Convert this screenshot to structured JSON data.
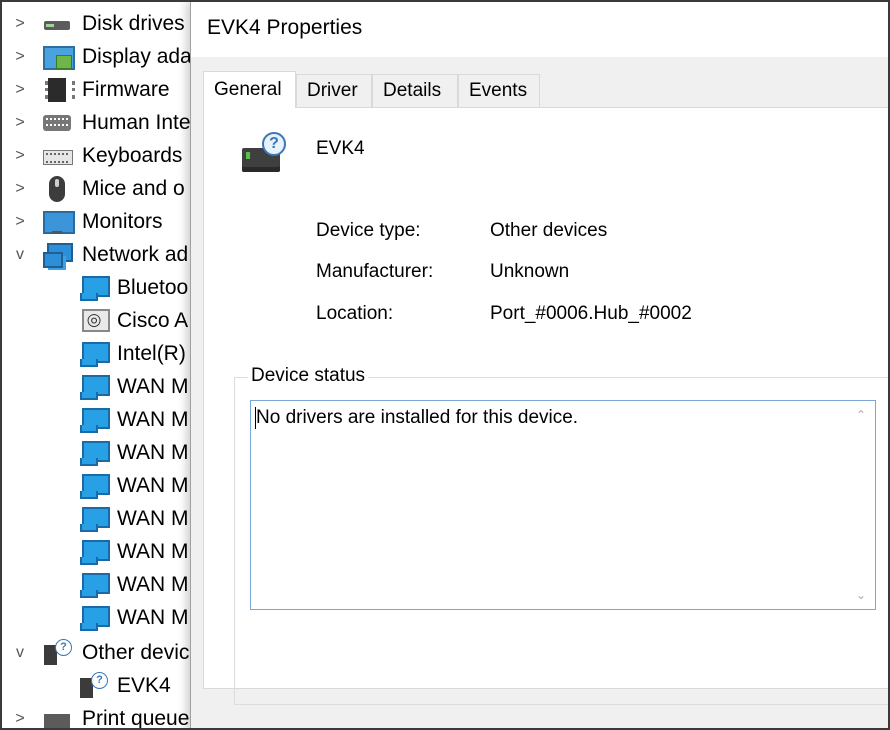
{
  "tree": {
    "items": [
      {
        "label": "Disk drives",
        "icon": "disk-drive-icon",
        "chevron": ">"
      },
      {
        "label": "Display ada",
        "icon": "display-adapter-icon",
        "chevron": ">"
      },
      {
        "label": "Firmware",
        "icon": "firmware-chip-icon",
        "chevron": ">"
      },
      {
        "label": "Human Inte",
        "icon": "human-interface-icon",
        "chevron": ">"
      },
      {
        "label": "Keyboards",
        "icon": "keyboard-icon",
        "chevron": ">"
      },
      {
        "label": "Mice and o",
        "icon": "mouse-icon",
        "chevron": ">"
      },
      {
        "label": "Monitors",
        "icon": "monitor-icon",
        "chevron": ">"
      },
      {
        "label": "Network ad",
        "icon": "network-adapter-icon",
        "chevron": "v"
      },
      {
        "label": "Bluetoo",
        "icon": "network-adapter-icon"
      },
      {
        "label": "Cisco A",
        "icon": "cisco-adapter-icon"
      },
      {
        "label": "Intel(R) ",
        "icon": "network-adapter-icon"
      },
      {
        "label": "WAN M",
        "icon": "network-adapter-icon"
      },
      {
        "label": "WAN M",
        "icon": "network-adapter-icon"
      },
      {
        "label": "WAN M",
        "icon": "network-adapter-icon"
      },
      {
        "label": "WAN M",
        "icon": "network-adapter-icon"
      },
      {
        "label": "WAN M",
        "icon": "network-adapter-icon"
      },
      {
        "label": "WAN M",
        "icon": "network-adapter-icon"
      },
      {
        "label": "WAN M",
        "icon": "network-adapter-icon"
      },
      {
        "label": "WAN M",
        "icon": "network-adapter-icon"
      },
      {
        "label": "Other devic",
        "icon": "unknown-device-icon",
        "chevron": "v"
      },
      {
        "label": "EVK4",
        "icon": "unknown-device-icon"
      },
      {
        "label": "Print queue",
        "icon": "printer-icon",
        "chevron": ">"
      }
    ]
  },
  "dialog": {
    "title": "EVK4 Properties",
    "tabs": [
      "General",
      "Driver",
      "Details",
      "Events"
    ],
    "active_tab": "General",
    "device_name": "EVK4",
    "properties": [
      {
        "label": "Device type:",
        "value": "Other devices"
      },
      {
        "label": "Manufacturer:",
        "value": "Unknown"
      },
      {
        "label": "Location:",
        "value": "Port_#0006.Hub_#0002"
      }
    ],
    "status_group_label": "Device status",
    "status_text": "No drivers are installed for this device."
  },
  "colors": {
    "accent_border": "#7aa7d6",
    "dialog_background": "#f0f0f0",
    "network_icon": "#27a0e5"
  }
}
